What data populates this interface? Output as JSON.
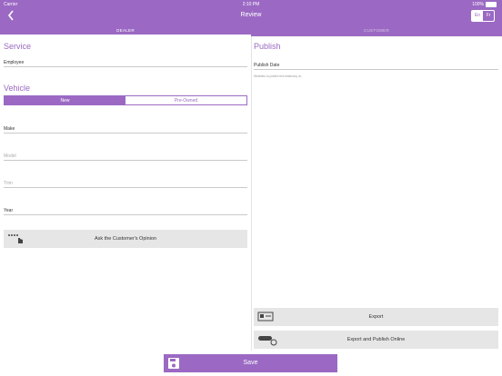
{
  "status": {
    "carrier": "Carrier",
    "time": "2:10 PM",
    "battery": "100%"
  },
  "nav": {
    "title": "Review",
    "lang": [
      "En",
      "Fr"
    ]
  },
  "tabs": {
    "dealer": "DEALER",
    "customer": "CUSTOMER"
  },
  "dealer": {
    "service_title": "Service",
    "employee_label": "Employee",
    "vehicle_title": "Vehicle",
    "condition": {
      "options": [
        "New",
        "Pre-Owned"
      ],
      "selected": "New"
    },
    "make_label": "Make",
    "model_placeholder": "Model",
    "trim_placeholder": "Trim",
    "year_label": "Year",
    "opinion_button": "Ask the Customer's Opinion"
  },
  "customer": {
    "publish_title": "Publish",
    "publish_date_label": "Publish Date",
    "publish_hint": "Websites to publish this testimony on"
  },
  "actions": {
    "export": "Export",
    "export_publish": "Export and Publish Online",
    "save": "Save"
  },
  "colors": {
    "accent": "#9b69c3",
    "button_bg": "#e6e6e6"
  }
}
